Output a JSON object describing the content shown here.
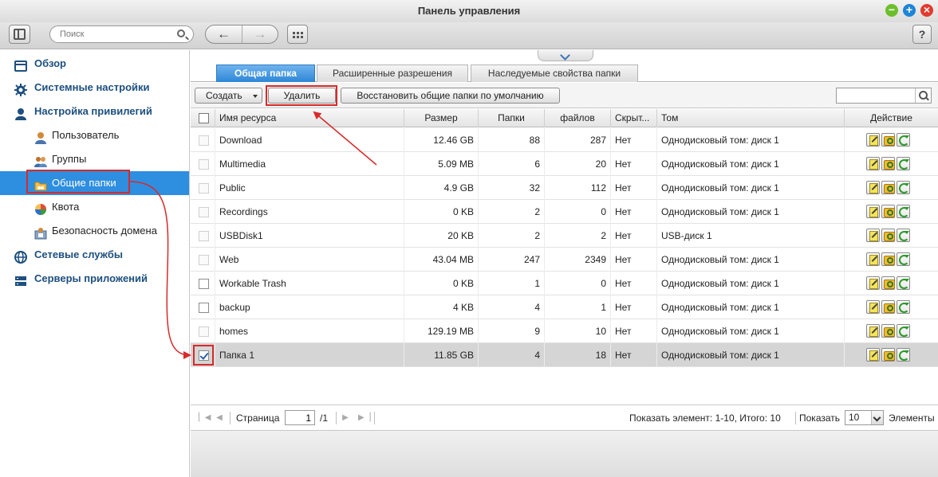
{
  "window": {
    "title": "Панель управления"
  },
  "toolbar": {
    "search_placeholder": "Поиск",
    "help_label": "?"
  },
  "sidebar": {
    "items": [
      {
        "label": "Обзор",
        "level": "top",
        "icon": "overview-icon"
      },
      {
        "label": "Системные настройки",
        "level": "top",
        "icon": "gear-icon"
      },
      {
        "label": "Настройка привилегий",
        "level": "top",
        "icon": "user-icon"
      },
      {
        "label": "Пользователь",
        "level": "sub",
        "icon": "user-icon"
      },
      {
        "label": "Группы",
        "level": "sub",
        "icon": "group-icon"
      },
      {
        "label": "Общие папки",
        "level": "sub",
        "icon": "shared-folder-icon",
        "active": true
      },
      {
        "label": "Квота",
        "level": "sub",
        "icon": "quota-icon"
      },
      {
        "label": "Безопасность домена",
        "level": "sub",
        "icon": "domain-security-icon"
      },
      {
        "label": "Сетевые службы",
        "level": "top",
        "icon": "network-icon"
      },
      {
        "label": "Серверы приложений",
        "level": "top",
        "icon": "server-icon"
      }
    ]
  },
  "tabs": [
    {
      "label": "Общая папка",
      "active": true
    },
    {
      "label": "Расширенные разрешения"
    },
    {
      "label": "Наследуемые свойства папки"
    }
  ],
  "actions": {
    "create": "Создать",
    "delete": "Удалить",
    "restore": "Восстановить общие папки по умолчанию"
  },
  "table": {
    "headers": {
      "name": "Имя ресурса",
      "size": "Размер",
      "folders": "Папки",
      "files": "файлов",
      "hidden": "Скрыт...",
      "volume": "Том",
      "action": "Действие"
    },
    "rows": [
      {
        "name": "Download",
        "size": "12.46 GB",
        "folders": "88",
        "files": "287",
        "hidden": "Нет",
        "volume": "Однодисковый том: диск 1",
        "checkbox": "disabled"
      },
      {
        "name": "Multimedia",
        "size": "5.09 MB",
        "folders": "6",
        "files": "20",
        "hidden": "Нет",
        "volume": "Однодисковый том: диск 1",
        "checkbox": "disabled"
      },
      {
        "name": "Public",
        "size": "4.9 GB",
        "folders": "32",
        "files": "112",
        "hidden": "Нет",
        "volume": "Однодисковый том: диск 1",
        "checkbox": "disabled"
      },
      {
        "name": "Recordings",
        "size": "0 KB",
        "folders": "2",
        "files": "0",
        "hidden": "Нет",
        "volume": "Однодисковый том: диск 1",
        "checkbox": "disabled"
      },
      {
        "name": "USBDisk1",
        "size": "20 KB",
        "folders": "2",
        "files": "2",
        "hidden": "Нет",
        "volume": "USB-диск 1",
        "checkbox": "disabled"
      },
      {
        "name": "Web",
        "size": "43.04 MB",
        "folders": "247",
        "files": "2349",
        "hidden": "Нет",
        "volume": "Однодисковый том: диск 1",
        "checkbox": "disabled"
      },
      {
        "name": "Workable Trash",
        "size": "0 KB",
        "folders": "1",
        "files": "0",
        "hidden": "Нет",
        "volume": "Однодисковый том: диск 1",
        "checkbox": "enabled"
      },
      {
        "name": "backup",
        "size": "4 KB",
        "folders": "4",
        "files": "1",
        "hidden": "Нет",
        "volume": "Однодисковый том: диск 1",
        "checkbox": "enabled"
      },
      {
        "name": "homes",
        "size": "129.19 MB",
        "folders": "9",
        "files": "10",
        "hidden": "Нет",
        "volume": "Однодисковый том: диск 1",
        "checkbox": "disabled"
      },
      {
        "name": "Папка 1",
        "size": "11.85 GB",
        "folders": "4",
        "files": "18",
        "hidden": "Нет",
        "volume": "Однодисковый том: диск 1",
        "checkbox": "checked",
        "selected": true
      }
    ]
  },
  "pager": {
    "page_label": "Страница",
    "page_value": "1",
    "page_total": "/1",
    "summary": "Показать элемент: 1-10, Итого: 10",
    "show_label": "Показать",
    "per_page": "10",
    "items_label": "Элементы"
  },
  "colors": {
    "accent": "#2e8ee0",
    "highlight": "#d82a2a",
    "title": "#1d4f7f"
  }
}
